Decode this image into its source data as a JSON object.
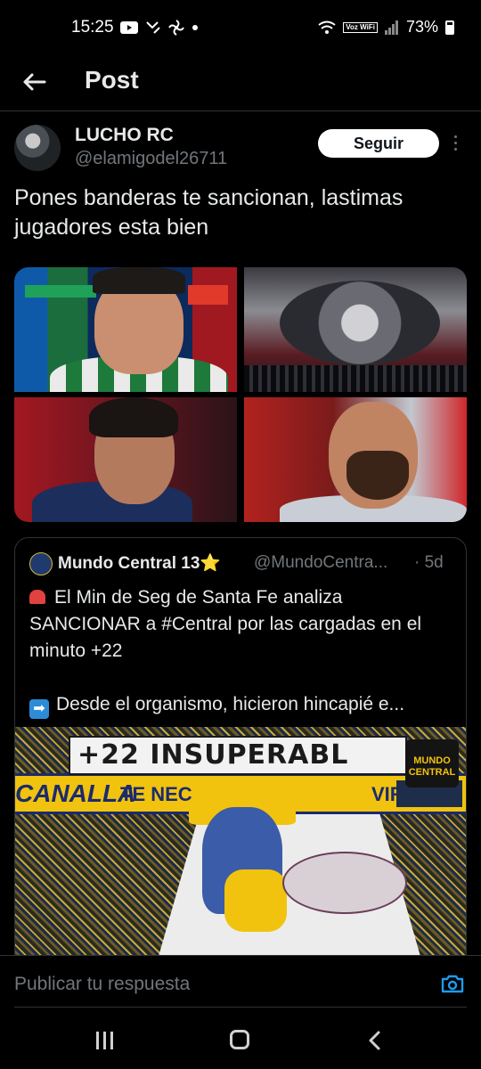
{
  "status_bar": {
    "time": "15:25",
    "battery": "73%",
    "wifi_label": "Voz WiFi",
    "icons": [
      "youtube-icon",
      "missed-call-icon",
      "fan-icon",
      "dot-icon",
      "wifi-icon",
      "signal-icon",
      "battery-icon"
    ]
  },
  "header": {
    "title": "Post",
    "back_icon": "arrow-left-icon"
  },
  "post": {
    "author_name": "LUCHO RC",
    "author_handle": "@elamigodel26711",
    "follow_label": "Seguir",
    "text": "Pones banderas te sancionan, lastimas jugadores esta bien",
    "image_count": 4
  },
  "quote": {
    "name": "Mundo Central 13⭐",
    "handle": "@MundoCentra...",
    "time": "· 5d",
    "line1": "El Min de Seg de Santa Fe analiza SANCIONAR a #Central por las cargadas en el minuto +22",
    "line2": "Desde el organismo, hicieron hincapié e...",
    "image": {
      "banner_top": "+22 INSUPERABL",
      "banner_mid_a": "CANALLA",
      "banner_mid_b": "TE NEC",
      "banner_mid_c": "VIR",
      "logo_text": "MUNDO CENTRAL"
    }
  },
  "reply": {
    "placeholder": "Publicar tu respuesta",
    "camera_icon": "camera-icon"
  },
  "navbar": {
    "icons": [
      "recent-apps-icon",
      "home-icon",
      "back-icon"
    ]
  }
}
